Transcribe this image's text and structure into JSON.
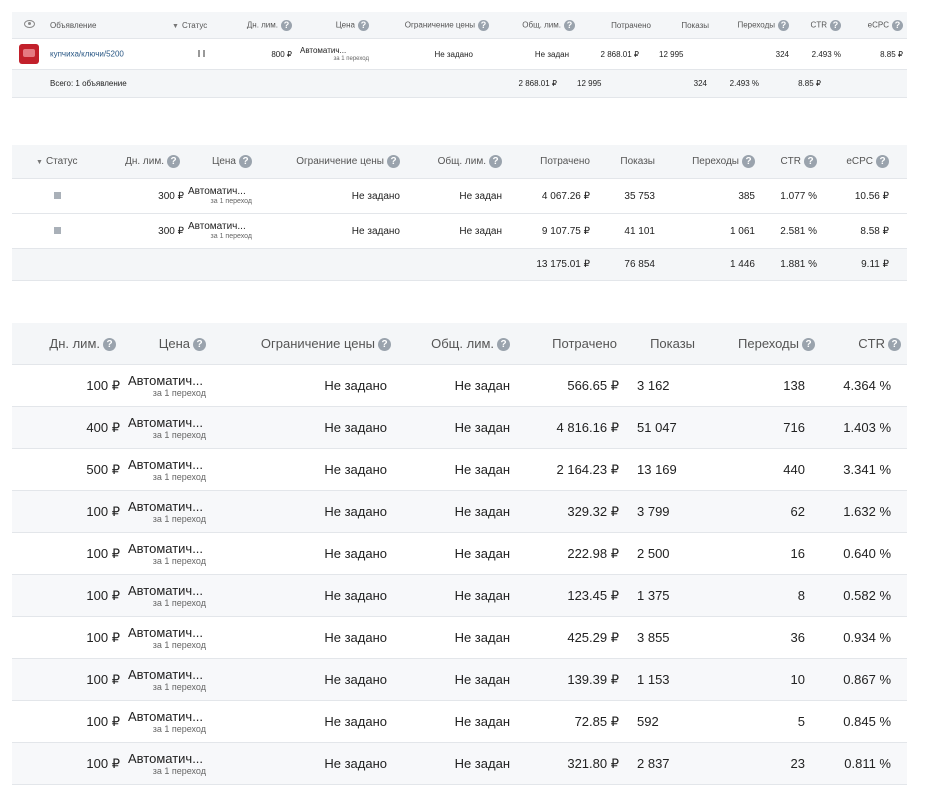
{
  "icons": {
    "help": "?"
  },
  "t1": {
    "headers": {
      "ad": "Объявление",
      "status": "Статус",
      "daily": "Дн. лим.",
      "price": "Цена",
      "limit": "Ограничение цены",
      "total": "Общ. лим.",
      "spent": "Потрачено",
      "shows": "Показы",
      "clicks": "Переходы",
      "ctr": "CTR",
      "ecpc": "eCPC"
    },
    "rows": [
      {
        "ad": "купчиха/ключи/5200",
        "daily": "800 ₽",
        "price": "Автоматич...",
        "price_sub": "за 1 переход",
        "limit": "Не задано",
        "total": "Не задан",
        "spent": "2 868.01 ₽",
        "shows": "12 995",
        "clicks": "324",
        "ctr": "2.493 %",
        "ecpc": "8.85 ₽"
      }
    ],
    "totals": {
      "label": "Всего: 1 объявление",
      "spent": "2 868.01 ₽",
      "shows": "12 995",
      "clicks": "324",
      "ctr": "2.493 %",
      "ecpc": "8.85 ₽"
    }
  },
  "t2": {
    "headers": {
      "status": "Статус",
      "daily": "Дн. лим.",
      "price": "Цена",
      "limit": "Ограничение цены",
      "total": "Общ. лим.",
      "spent": "Потрачено",
      "shows": "Показы",
      "clicks": "Переходы",
      "ctr": "CTR",
      "ecpc": "eCPC"
    },
    "rows": [
      {
        "daily": "300 ₽",
        "price": "Автоматич...",
        "price_sub": "за 1 переход",
        "limit": "Не задано",
        "total": "Не задан",
        "spent": "4 067.26 ₽",
        "shows": "35 753",
        "clicks": "385",
        "ctr": "1.077 %",
        "ecpc": "10.56 ₽"
      },
      {
        "daily": "300 ₽",
        "price": "Автоматич...",
        "price_sub": "за 1 переход",
        "limit": "Не задано",
        "total": "Не задан",
        "spent": "9 107.75 ₽",
        "shows": "41 101",
        "clicks": "1 061",
        "ctr": "2.581 %",
        "ecpc": "8.58 ₽"
      }
    ],
    "totals": {
      "spent": "13 175.01 ₽",
      "shows": "76 854",
      "clicks": "1 446",
      "ctr": "1.881 %",
      "ecpc": "9.11 ₽"
    }
  },
  "t3": {
    "headers": {
      "daily": "Дн. лим.",
      "price": "Цена",
      "limit": "Ограничение цены",
      "total": "Общ. лим.",
      "spent": "Потрачено",
      "shows": "Показы",
      "clicks": "Переходы",
      "ctr": "CTR"
    },
    "rows": [
      {
        "daily": "100 ₽",
        "price": "Автоматич...",
        "price_sub": "за 1 переход",
        "limit": "Не задано",
        "total": "Не задан",
        "spent": "566.65 ₽",
        "shows": "3 162",
        "clicks": "138",
        "ctr": "4.364 %"
      },
      {
        "daily": "400 ₽",
        "price": "Автоматич...",
        "price_sub": "за 1 переход",
        "limit": "Не задано",
        "total": "Не задан",
        "spent": "4 816.16 ₽",
        "shows": "51 047",
        "clicks": "716",
        "ctr": "1.403 %"
      },
      {
        "daily": "500 ₽",
        "price": "Автоматич...",
        "price_sub": "за 1 переход",
        "limit": "Не задано",
        "total": "Не задан",
        "spent": "2 164.23 ₽",
        "shows": "13 169",
        "clicks": "440",
        "ctr": "3.341 %"
      },
      {
        "daily": "100 ₽",
        "price": "Автоматич...",
        "price_sub": "за 1 переход",
        "limit": "Не задано",
        "total": "Не задан",
        "spent": "329.32 ₽",
        "shows": "3 799",
        "clicks": "62",
        "ctr": "1.632 %"
      },
      {
        "daily": "100 ₽",
        "price": "Автоматич...",
        "price_sub": "за 1 переход",
        "limit": "Не задано",
        "total": "Не задан",
        "spent": "222.98 ₽",
        "shows": "2 500",
        "clicks": "16",
        "ctr": "0.640 %"
      },
      {
        "daily": "100 ₽",
        "price": "Автоматич...",
        "price_sub": "за 1 переход",
        "limit": "Не задано",
        "total": "Не задан",
        "spent": "123.45 ₽",
        "shows": "1 375",
        "clicks": "8",
        "ctr": "0.582 %"
      },
      {
        "daily": "100 ₽",
        "price": "Автоматич...",
        "price_sub": "за 1 переход",
        "limit": "Не задано",
        "total": "Не задан",
        "spent": "425.29 ₽",
        "shows": "3 855",
        "clicks": "36",
        "ctr": "0.934 %"
      },
      {
        "daily": "100 ₽",
        "price": "Автоматич...",
        "price_sub": "за 1 переход",
        "limit": "Не задано",
        "total": "Не задан",
        "spent": "139.39 ₽",
        "shows": "1 153",
        "clicks": "10",
        "ctr": "0.867 %"
      },
      {
        "daily": "100 ₽",
        "price": "Автоматич...",
        "price_sub": "за 1 переход",
        "limit": "Не задано",
        "total": "Не задан",
        "spent": "72.85 ₽",
        "shows": "592",
        "clicks": "5",
        "ctr": "0.845 %"
      },
      {
        "daily": "100 ₽",
        "price": "Автоматич...",
        "price_sub": "за 1 переход",
        "limit": "Не задано",
        "total": "Не задан",
        "spent": "321.80 ₽",
        "shows": "2 837",
        "clicks": "23",
        "ctr": "0.811 %"
      }
    ]
  }
}
